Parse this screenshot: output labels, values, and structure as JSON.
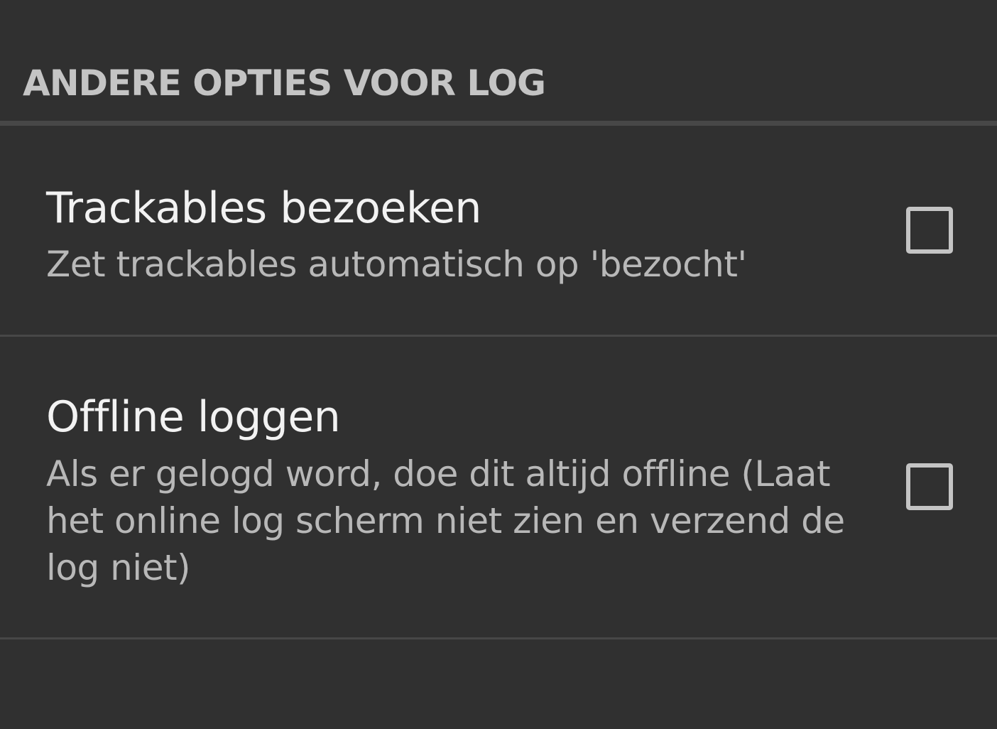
{
  "section": {
    "title": "ANDERE OPTIES VOOR LOG"
  },
  "preferences": [
    {
      "title": "Trackables bezoeken",
      "summary": "Zet trackables automatisch op 'bezocht'",
      "checked": false
    },
    {
      "title": "Offline loggen",
      "summary": "Als er gelogd word, doe dit altijd offline (Laat het online log scherm niet zien en verzend de log niet)",
      "checked": false
    }
  ],
  "colors": {
    "background": "#303030",
    "divider": "#474747",
    "header_text": "#c4c4c4",
    "title_text": "#f2f2f2",
    "summary_text": "#b8b8b8",
    "checkbox_border": "#c4c4c4"
  }
}
